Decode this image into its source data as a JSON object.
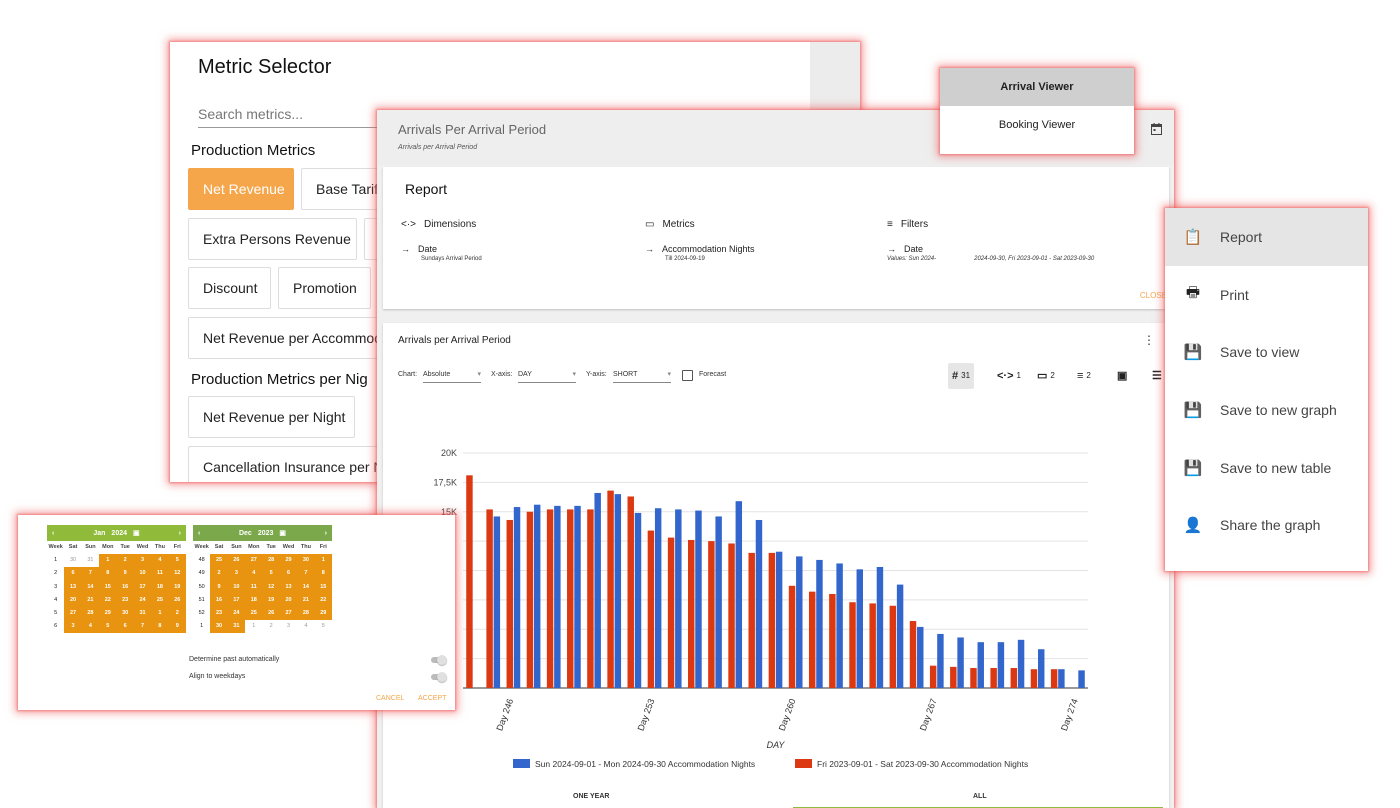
{
  "metric_selector": {
    "title": "Metric Selector",
    "search_placeholder": "Search metrics...",
    "groups": [
      {
        "title": "Production Metrics",
        "chips": [
          "Net Revenue",
          "Base Tarif",
          "Extra Persons Revenue",
          "Discount",
          "Promotion",
          "Net Revenue per Accommod"
        ]
      },
      {
        "title": "Production Metrics per Nig",
        "chips": [
          "Net Revenue per Night",
          "Cancellation Insurance per N"
        ]
      }
    ]
  },
  "arrivals": {
    "title": "Arrivals Per Arrival Period",
    "subtitle": "Arrivals per Arrival Period",
    "report": {
      "title": "Report",
      "dimensions": {
        "label": "Dimensions",
        "item": "Date",
        "detail": "Sundays Arrival Period"
      },
      "metrics": {
        "label": "Metrics",
        "item": "Accommodation Nights",
        "detail": "Till 2024-09-19"
      },
      "filters": {
        "label": "Filters",
        "item": "Date",
        "detail": "Values: Sun 2024-",
        "detail2": "2024-09-30, Fri 2023-09-01 - Sat 2023-09-30"
      },
      "close": "CLOSE"
    },
    "chart_card": {
      "title": "Arrivals per Arrival Period",
      "chart_label": "Chart:",
      "chart_value": "Absolute",
      "xaxis_label": "X-axis:",
      "xaxis_value": "DAY",
      "yaxis_label": "Y-axis:",
      "yaxis_value": "SHORT",
      "forecast_label": "Forecast",
      "toolbar": {
        "count": "31",
        "dims": "1",
        "metrics": "2",
        "filters": "2"
      },
      "tabs": [
        "ONE YEAR",
        "ALL"
      ]
    }
  },
  "chart_data": {
    "type": "bar",
    "xlabel": "DAY",
    "ylabel": "",
    "ylim": [
      0,
      20000
    ],
    "yticks": [
      "20K",
      "17,5K",
      "15K"
    ],
    "xtick_labels": [
      "Day 246",
      "Day 253",
      "Day 260",
      "Day 267",
      "Day 274"
    ],
    "categories": [
      "244",
      "245",
      "246",
      "247",
      "248",
      "249",
      "250",
      "251",
      "252",
      "253",
      "254",
      "255",
      "256",
      "257",
      "258",
      "259",
      "260",
      "261",
      "262",
      "263",
      "264",
      "265",
      "266",
      "267",
      "268",
      "269",
      "270",
      "271",
      "272",
      "273",
      "274"
    ],
    "series": [
      {
        "name": "Sun 2024-09-01 - Mon 2024-09-30 Accommodation Nights",
        "color": "#3366cc",
        "values": [
          null,
          14600,
          15400,
          15600,
          15500,
          15500,
          16600,
          16500,
          14900,
          15300,
          15200,
          15100,
          14600,
          15900,
          14300,
          11600,
          11200,
          10900,
          10600,
          10100,
          10300,
          8800,
          5200,
          4600,
          4300,
          3900,
          3900,
          4100,
          3300,
          1600,
          1500
        ]
      },
      {
        "name": "Fri 2023-09-01 - Sat 2023-09-30 Accommodation Nights",
        "color": "#dc3912",
        "values": [
          18100,
          15200,
          14300,
          15000,
          15200,
          15200,
          15200,
          16800,
          16300,
          13400,
          12800,
          12600,
          12500,
          12300,
          11500,
          11500,
          8700,
          8200,
          8000,
          7300,
          7200,
          7000,
          5700,
          1900,
          1800,
          1700,
          1700,
          1700,
          1600,
          1600,
          null
        ]
      }
    ],
    "legend": "bottom"
  },
  "viewer_menu": {
    "items": [
      "Arrival Viewer",
      "Booking Viewer"
    ],
    "selected": 0
  },
  "actions_menu": {
    "items": [
      "Report",
      "Print",
      "Save to view",
      "Save to new graph",
      "Save to new table",
      "Share the graph"
    ]
  },
  "date_picker": {
    "left": {
      "month": "Jan",
      "year": "2024",
      "weekdays": [
        "Week",
        "Sat",
        "Sun",
        "Mon",
        "Tue",
        "Wed",
        "Thu",
        "Fri"
      ],
      "rows": [
        [
          "1",
          "30",
          "31",
          "1",
          "2",
          "3",
          "4",
          "5"
        ],
        [
          "2",
          "6",
          "7",
          "8",
          "9",
          "10",
          "11",
          "12"
        ],
        [
          "3",
          "13",
          "14",
          "15",
          "16",
          "17",
          "18",
          "19"
        ],
        [
          "4",
          "20",
          "21",
          "22",
          "23",
          "24",
          "25",
          "26"
        ],
        [
          "5",
          "27",
          "28",
          "29",
          "30",
          "31",
          "1",
          "2"
        ],
        [
          "6",
          "3",
          "4",
          "5",
          "6",
          "7",
          "8",
          "9"
        ]
      ]
    },
    "right": {
      "month": "Dec",
      "year": "2023",
      "weekdays": [
        "Week",
        "Sat",
        "Sun",
        "Mon",
        "Tue",
        "Wed",
        "Thu",
        "Fri"
      ],
      "rows": [
        [
          "48",
          "25",
          "26",
          "27",
          "28",
          "29",
          "30",
          "1"
        ],
        [
          "49",
          "2",
          "3",
          "4",
          "5",
          "6",
          "7",
          "8"
        ],
        [
          "50",
          "9",
          "10",
          "11",
          "12",
          "13",
          "14",
          "15"
        ],
        [
          "51",
          "16",
          "17",
          "18",
          "19",
          "20",
          "21",
          "22"
        ],
        [
          "52",
          "23",
          "24",
          "25",
          "26",
          "27",
          "28",
          "29"
        ],
        [
          "1",
          "30",
          "31",
          "1",
          "2",
          "3",
          "4",
          "5"
        ]
      ]
    },
    "options": [
      "Determine past automatically",
      "Align to weekdays"
    ],
    "cancel": "CANCEL",
    "accept": "ACCEPT"
  }
}
